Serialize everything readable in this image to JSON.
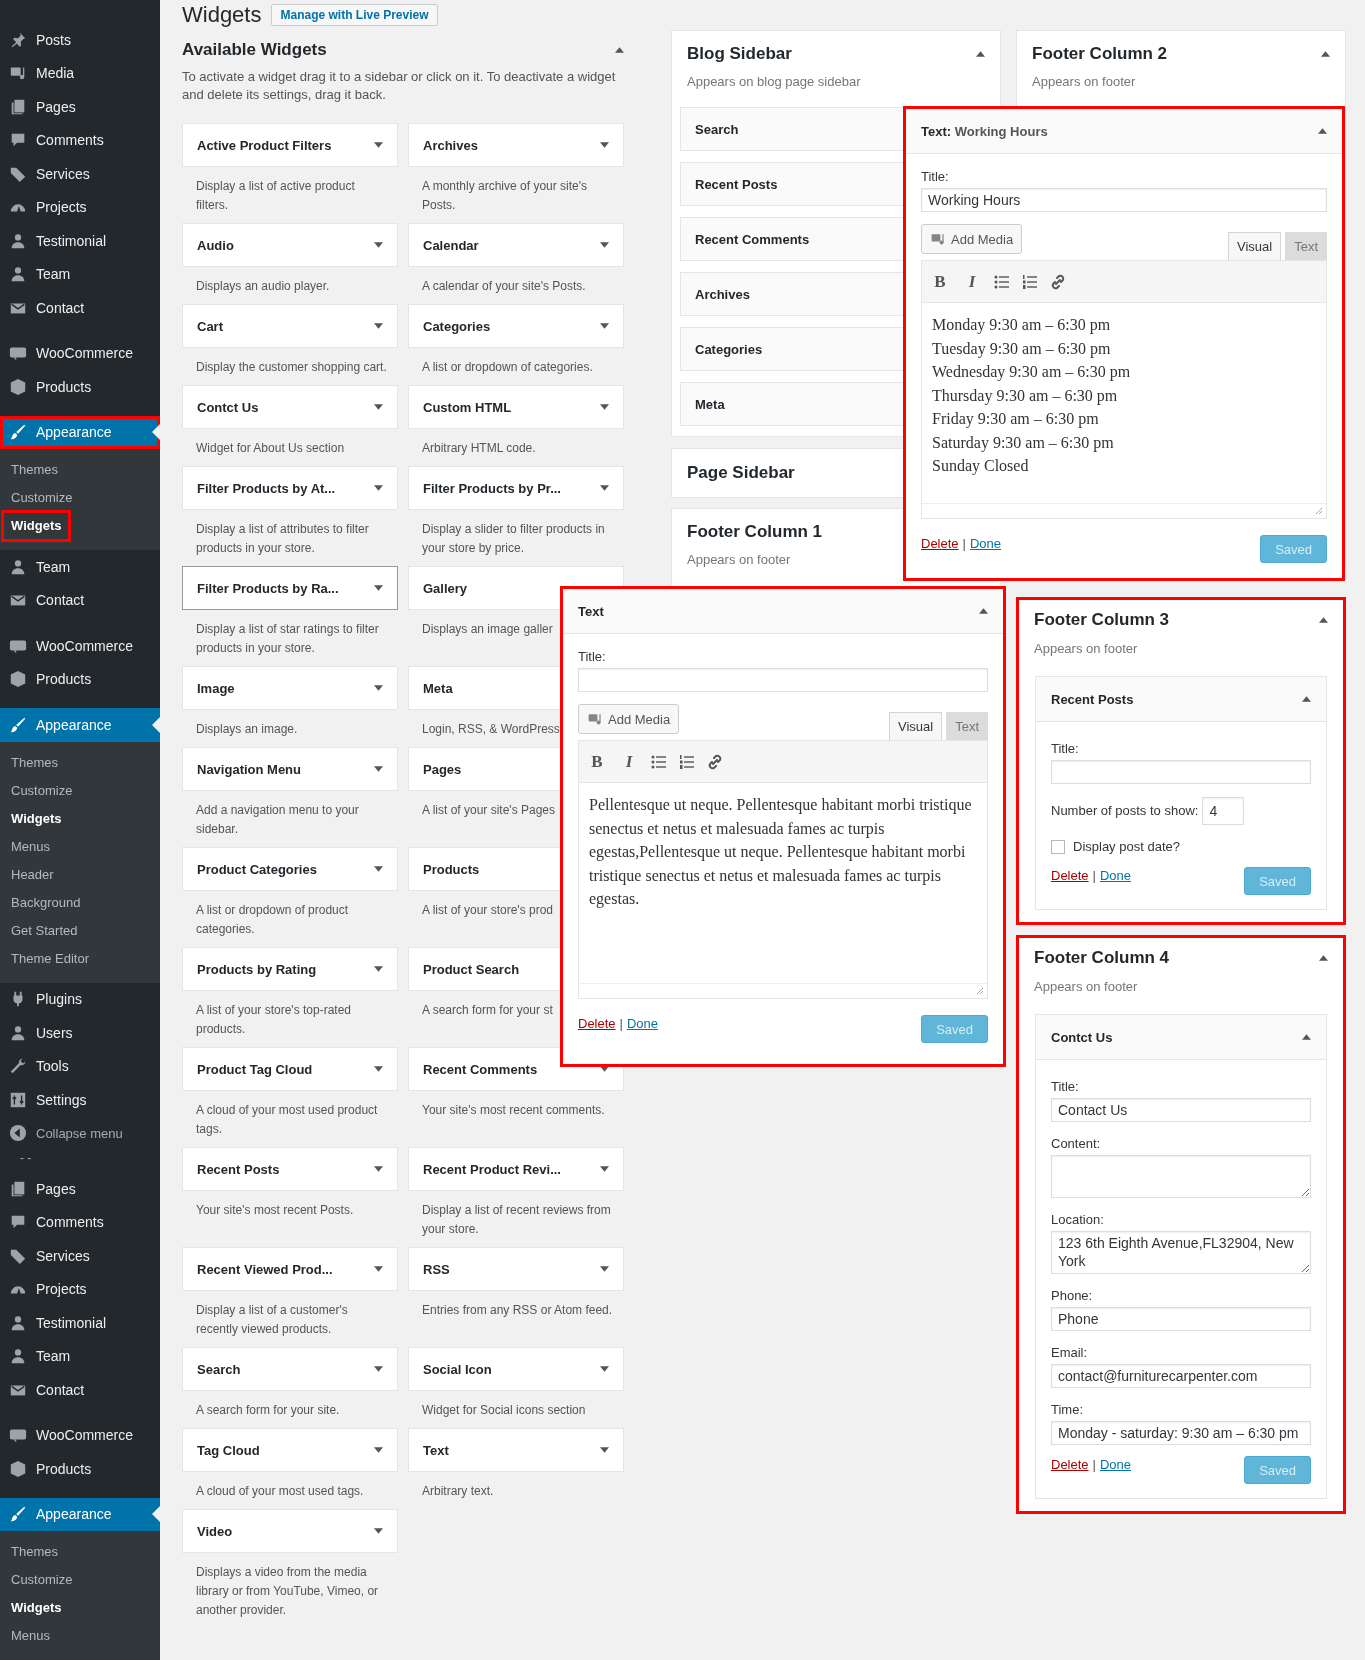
{
  "sidebar": {
    "items": [
      {
        "kind": "menu",
        "label": "Posts",
        "selected": false,
        "highlighted": false
      },
      {
        "kind": "menu",
        "label": "Media",
        "selected": false,
        "highlighted": false
      },
      {
        "kind": "menu",
        "label": "Pages",
        "selected": false,
        "highlighted": false
      },
      {
        "kind": "menu",
        "label": "Comments",
        "selected": false,
        "highlighted": false
      },
      {
        "kind": "menu",
        "label": "Services",
        "selected": false,
        "highlighted": false
      },
      {
        "kind": "menu",
        "label": "Projects",
        "selected": false,
        "highlighted": false
      },
      {
        "kind": "menu",
        "label": "Testimonial",
        "selected": false,
        "highlighted": false
      },
      {
        "kind": "menu",
        "label": "Team",
        "selected": false,
        "highlighted": false
      },
      {
        "kind": "menu",
        "label": "Contact",
        "selected": false,
        "highlighted": false
      },
      {
        "kind": "separator"
      },
      {
        "kind": "menu",
        "label": "WooCommerce",
        "selected": false,
        "highlighted": false
      },
      {
        "kind": "menu",
        "label": "Products",
        "selected": false,
        "highlighted": false
      },
      {
        "kind": "separator"
      },
      {
        "kind": "menu",
        "label": "Appearance",
        "selected": true,
        "highlighted": true,
        "children": [
          {
            "label": "Themes",
            "selected": false,
            "highlighted": false
          },
          {
            "label": "Customize",
            "selected": false,
            "highlighted": false
          },
          {
            "label": "Widgets",
            "selected": true,
            "highlighted": true
          }
        ]
      },
      {
        "kind": "menu",
        "label": "Team",
        "selected": false,
        "highlighted": false
      },
      {
        "kind": "menu",
        "label": "Contact",
        "selected": false,
        "highlighted": false
      },
      {
        "kind": "separator"
      },
      {
        "kind": "menu",
        "label": "WooCommerce",
        "selected": false,
        "highlighted": false
      },
      {
        "kind": "menu",
        "label": "Products",
        "selected": false,
        "highlighted": false
      },
      {
        "kind": "separator"
      },
      {
        "kind": "menu",
        "label": "Appearance",
        "selected": true,
        "highlighted": false,
        "children": [
          {
            "label": "Themes",
            "selected": false,
            "highlighted": false
          },
          {
            "label": "Customize",
            "selected": false,
            "highlighted": false
          },
          {
            "label": "Widgets",
            "selected": true,
            "highlighted": false
          },
          {
            "label": "Menus",
            "selected": false,
            "highlighted": false
          },
          {
            "label": "Header",
            "selected": false,
            "highlighted": false
          },
          {
            "label": "Background",
            "selected": false,
            "highlighted": false
          },
          {
            "label": "Get Started",
            "selected": false,
            "highlighted": false
          },
          {
            "label": "Theme Editor",
            "selected": false,
            "highlighted": false
          }
        ]
      },
      {
        "kind": "menu",
        "label": "Plugins",
        "selected": false,
        "highlighted": false
      },
      {
        "kind": "menu",
        "label": "Users",
        "selected": false,
        "highlighted": false
      },
      {
        "kind": "menu",
        "label": "Tools",
        "selected": false,
        "highlighted": false
      },
      {
        "kind": "menu",
        "label": "Settings",
        "selected": false,
        "highlighted": false
      },
      {
        "kind": "collapse",
        "label": "Collapse menu"
      },
      {
        "kind": "fragment",
        "label": "- -"
      },
      {
        "kind": "menu",
        "label": "Pages",
        "selected": false,
        "highlighted": false
      },
      {
        "kind": "menu",
        "label": "Comments",
        "selected": false,
        "highlighted": false
      },
      {
        "kind": "menu",
        "label": "Services",
        "selected": false,
        "highlighted": false
      },
      {
        "kind": "menu",
        "label": "Projects",
        "selected": false,
        "highlighted": false
      },
      {
        "kind": "menu",
        "label": "Testimonial",
        "selected": false,
        "highlighted": false
      },
      {
        "kind": "menu",
        "label": "Team",
        "selected": false,
        "highlighted": false
      },
      {
        "kind": "menu",
        "label": "Contact",
        "selected": false,
        "highlighted": false
      },
      {
        "kind": "separator"
      },
      {
        "kind": "menu",
        "label": "WooCommerce",
        "selected": false,
        "highlighted": false
      },
      {
        "kind": "menu",
        "label": "Products",
        "selected": false,
        "highlighted": false
      },
      {
        "kind": "separator"
      },
      {
        "kind": "menu",
        "label": "Appearance",
        "selected": true,
        "highlighted": false,
        "children": [
          {
            "label": "Themes",
            "selected": false,
            "highlighted": false
          },
          {
            "label": "Customize",
            "selected": false,
            "highlighted": false
          },
          {
            "label": "Widgets",
            "selected": true,
            "highlighted": false
          },
          {
            "label": "Menus",
            "selected": false,
            "highlighted": false
          }
        ]
      }
    ]
  },
  "page_title": "Widgets",
  "live_preview_button": "Manage with Live Preview",
  "available_widgets": {
    "title": "Available Widgets",
    "expanded": true,
    "description": "To activate a widget drag it to a sidebar or click on it. To deactivate a widget and delete its settings, drag it back.",
    "widgets": [
      {
        "name": "Active Product Filters",
        "description": "Display a list of active product filters.",
        "hovered": false
      },
      {
        "name": "Archives",
        "description": "A monthly archive of your site's Posts.",
        "hovered": false
      },
      {
        "name": "Audio",
        "description": "Displays an audio player.",
        "hovered": false
      },
      {
        "name": "Calendar",
        "description": "A calendar of your site's Posts.",
        "hovered": false
      },
      {
        "name": "Cart",
        "description": "Display the customer shopping cart.",
        "hovered": false
      },
      {
        "name": "Categories",
        "description": "A list or dropdown of categories.",
        "hovered": false
      },
      {
        "name": "Contct Us",
        "description": "Widget for About Us section",
        "hovered": false
      },
      {
        "name": "Custom HTML",
        "description": "Arbitrary HTML code.",
        "hovered": false
      },
      {
        "name": "Filter Products by At...",
        "description": "Display a list of attributes to filter products in your store.",
        "hovered": false
      },
      {
        "name": "Filter Products by Pr...",
        "description": "Display a slider to filter products in your store by price.",
        "hovered": false
      },
      {
        "name": "Filter Products by Ra...",
        "description": "Display a list of star ratings to filter products in your store.",
        "hovered": true
      },
      {
        "name": "Gallery",
        "description": "Displays an image galler",
        "hovered": false
      },
      {
        "name": "Image",
        "description": "Displays an image.",
        "hovered": false
      },
      {
        "name": "Meta",
        "description": "Login, RSS, & WordPress.",
        "hovered": false
      },
      {
        "name": "Navigation Menu",
        "description": "Add a navigation menu to your sidebar.",
        "hovered": false
      },
      {
        "name": "Pages",
        "description": "A list of your site's Pages",
        "hovered": false
      },
      {
        "name": "Product Categories",
        "description": "A list or dropdown of product categories.",
        "hovered": false
      },
      {
        "name": "Products",
        "description": "A list of your store's prod",
        "hovered": false
      },
      {
        "name": "Products by Rating",
        "description": "A list of your store's top-rated products.",
        "hovered": false
      },
      {
        "name": "Product Search",
        "description": "A search form for your st",
        "hovered": false
      },
      {
        "name": "Product Tag Cloud",
        "description": "A cloud of your most used product tags.",
        "hovered": false
      },
      {
        "name": "Recent Comments",
        "description": "Your site's most recent comments.",
        "hovered": false
      },
      {
        "name": "Recent Posts",
        "description": "Your site's most recent Posts.",
        "hovered": false
      },
      {
        "name": "Recent Product Revi...",
        "description": "Display a list of recent reviews from your store.",
        "hovered": false
      },
      {
        "name": "Recent Viewed Prod...",
        "description": "Display a list of a customer's recently viewed products.",
        "hovered": false
      },
      {
        "name": "RSS",
        "description": "Entries from any RSS or Atom feed.",
        "hovered": false
      },
      {
        "name": "Search",
        "description": "A search form for your site.",
        "hovered": false
      },
      {
        "name": "Social Icon",
        "description": "Widget for Social icons section",
        "hovered": false
      },
      {
        "name": "Tag Cloud",
        "description": "A cloud of your most used tags.",
        "hovered": false
      },
      {
        "name": "Text",
        "description": "Arbitrary text.",
        "hovered": false
      },
      {
        "name": "Video",
        "description": "Displays a video from the media library or from YouTube, Vimeo, or another provider.",
        "hovered": false
      }
    ]
  },
  "blog_sidebar": {
    "name": "Blog Sidebar",
    "description": "Appears on blog page sidebar",
    "expanded": true,
    "widgets": [
      {
        "name": "Search"
      },
      {
        "name": "Recent Posts"
      },
      {
        "name": "Recent Comments"
      },
      {
        "name": "Archives"
      },
      {
        "name": "Categories"
      },
      {
        "name": "Meta"
      }
    ]
  },
  "page_sidebar": {
    "name": "Page Sidebar"
  },
  "footer_column_1": {
    "name": "Footer Column 1",
    "description": "Appears on footer"
  },
  "footer_column_2": {
    "name": "Footer Column 2",
    "description": "Appears on footer",
    "expanded": true
  },
  "working_hours_widget": {
    "highlighted": true,
    "expanded": true,
    "title": "Text:",
    "instance_title": "Working Hours",
    "title_label": "Title:",
    "title_value": "Working Hours",
    "add_media": "Add Media",
    "editor_tabs": [
      {
        "label": "Visual",
        "selected": true
      },
      {
        "label": "Text",
        "selected": false
      }
    ],
    "format_buttons": [
      "B",
      "I"
    ],
    "content": [
      "Monday 9:30 am – 6:30 pm",
      "Tuesday 9:30 am – 6:30 pm",
      "Wednesday 9:30 am – 6:30 pm",
      "Thursday 9:30 am – 6:30 pm",
      "Friday 9:30 am – 6:30 pm",
      "Saturday 9:30 am – 6:30 pm",
      "Sunday Closed"
    ],
    "delete_link": "Delete",
    "link_separator": "|",
    "done_link": "Done",
    "save_button": "Saved"
  },
  "text_widget": {
    "highlighted": true,
    "expanded": true,
    "title": "Text",
    "title_label": "Title:",
    "add_media": "Add Media",
    "editor_tabs": [
      {
        "label": "Visual",
        "selected": true
      },
      {
        "label": "Text",
        "selected": false
      }
    ],
    "format_buttons": [
      "B",
      "I"
    ],
    "content": [
      "Pellentesque ut neque. Pellentesque habitant morbi tristique senectus et netus et malesuada fames ac turpis egestas,Pellentesque ut neque. Pellentesque habitant morbi tristique senectus et netus et malesuada fames ac turpis egestas."
    ],
    "delete_link": "Delete",
    "link_separator": "|",
    "done_link": "Done",
    "save_button": "Saved"
  },
  "footer_column_3": {
    "name": "Footer Column 3",
    "description": "Appears on footer",
    "expanded": true,
    "highlighted": true,
    "widget": {
      "title": "Recent Posts",
      "expanded": true,
      "fields": [
        {
          "kind": "text",
          "label": "Title:"
        },
        {
          "kind": "number",
          "label": "Number of posts to show:",
          "value": "4"
        },
        {
          "kind": "checkbox",
          "label": "Display post date?",
          "checked": false
        }
      ],
      "delete_link": "Delete",
      "link_separator": "|",
      "done_link": "Done",
      "save_button": "Saved"
    }
  },
  "footer_column_4": {
    "name": "Footer Column 4",
    "description": "Appears on footer",
    "expanded": true,
    "highlighted": true,
    "widget": {
      "title": "Contct Us",
      "expanded": true,
      "fields": [
        {
          "kind": "text",
          "label": "Title:",
          "value": "Contact Us"
        },
        {
          "kind": "textarea",
          "label": "Content:"
        },
        {
          "kind": "textarea",
          "label": "Location:",
          "value": "123 6th Eighth Avenue,FL32904, New York"
        },
        {
          "kind": "text",
          "label": "Phone:",
          "value": "Phone"
        },
        {
          "kind": "text",
          "label": "Email:",
          "value": "contact@furniturecarpenter.com"
        },
        {
          "kind": "text",
          "label": "Time:",
          "value": "Monday - saturday: 9:30 am – 6:30 pm"
        }
      ],
      "delete_link": "Delete",
      "link_separator": "|",
      "done_link": "Done",
      "save_button": "Saved"
    }
  }
}
